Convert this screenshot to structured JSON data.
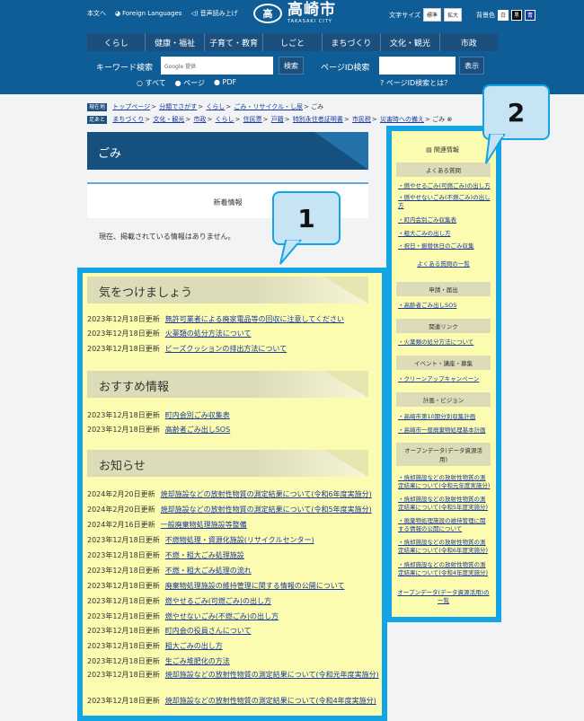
{
  "header": {
    "skip": "本文へ",
    "foreign": "Foreign Languages",
    "voice": "音声読み上げ",
    "logo_mark": "高",
    "logo_jp": "高崎市",
    "logo_en": "TAKASAKI CITY",
    "font_size_label": "文字サイズ",
    "font_std": "標準",
    "font_large": "拡大",
    "bg_label": "背景色",
    "bg_white": "白",
    "bg_black": "黒",
    "bg_blue": "青"
  },
  "gnav": [
    "くらし",
    "健康・福祉",
    "子育て・教育",
    "しごと",
    "まちづくり",
    "文化・観光",
    "市政"
  ],
  "search": {
    "keyword_label": "キーワード検索",
    "keyword_placeholder": "Google 提供",
    "keyword_btn": "検索",
    "radio_all": "○ すべて",
    "radio_page": "● ページ",
    "radio_pdf": "● PDF",
    "pageid_label": "ページID検索",
    "pageid_btn": "表示",
    "pageid_help": "? ページID検索とは？"
  },
  "breadcrumb1": {
    "tag": "現在地",
    "links": [
      "トップページ",
      "分類でさがす",
      "くらし",
      "ごみ・リサイクル・し尿"
    ],
    "current": "ごみ"
  },
  "breadcrumb2": {
    "tag": "足あと",
    "links": [
      "まちづくり",
      "文化・観光",
      "市政",
      "くらし",
      "住民票",
      "戸籍",
      "特別永住者証明書",
      "市民税",
      "災害時への備え"
    ],
    "current": "ごみ"
  },
  "main": {
    "title": "ごみ",
    "new_info": "新着情報",
    "no_info": "現在、掲載されている情報はありません。"
  },
  "sections": [
    {
      "heading": "気をつけましょう",
      "items": [
        {
          "date": "2023年12月18日更新",
          "text": "無許可業者による廃家電品等の回収に注意してください"
        },
        {
          "date": "2023年12月18日更新",
          "text": "火薬類の処分方法について"
        },
        {
          "date": "2023年12月18日更新",
          "text": "ビーズクッションの排出方法について"
        }
      ]
    },
    {
      "heading": "おすすめ情報",
      "items": [
        {
          "date": "2023年12月18日更新",
          "text": "町内会別ごみ収集表"
        },
        {
          "date": "2023年12月18日更新",
          "text": "高齢者ごみ出しSOS"
        }
      ]
    },
    {
      "heading": "お知らせ",
      "items": [
        {
          "date": "2024年2月20日更新",
          "text": "焼却施設などの放射性物質の測定結果について(令和6年度実施分)"
        },
        {
          "date": "2024年2月20日更新",
          "text": "焼却施設などの放射性物質の測定結果について(令和5年度実施分)"
        },
        {
          "date": "2024年2月16日更新",
          "text": "一般廃棄物処理施設等整備"
        },
        {
          "date": "2023年12月18日更新",
          "text": "不燃物処理・資源化施設(リサイクルセンター)"
        },
        {
          "date": "2023年12月18日更新",
          "text": "不燃・粗大ごみ処理施設"
        },
        {
          "date": "2023年12月18日更新",
          "text": "不燃・粗大ごみ処理の流れ"
        },
        {
          "date": "2023年12月18日更新",
          "text": "廃棄物処理施設の維持管理に関する情報の公開について"
        },
        {
          "date": "2023年12月18日更新",
          "text": "燃やせるごみ(可燃ごみ)の出し方"
        },
        {
          "date": "2023年12月18日更新",
          "text": "燃やせないごみ(不燃ごみ)の出し方"
        },
        {
          "date": "2023年12月18日更新",
          "text": "町内会の役員さんについて"
        },
        {
          "date": "2023年12月18日更新",
          "text": "粗大ごみの出し方"
        },
        {
          "date": "2023年12月18日更新",
          "text": "生ごみ堆肥化の方法"
        },
        {
          "date": "2023年12月18日更新",
          "text": "焼却施設などの放射性物質の測定結果について(令和元年度実施分)"
        },
        {
          "date": "2023年12月18日更新",
          "text": "焼却施設などの放射性物質の測定結果について(令和4年度実施分)"
        }
      ]
    }
  ],
  "sidebar": {
    "heading": "関連情報",
    "faq_title": "よくある質問",
    "faq": [
      "燃やせるごみ(可燃ごみ)の出し方",
      "燃やせないごみ(不燃ごみ)の出し方",
      "町内会別ごみ収集表",
      "粗大ごみの出し方",
      "祝日・振替休日のごみ収集"
    ],
    "faq_more": "よくある質問の一覧",
    "apply_title": "申請・届出",
    "apply": [
      "高齢者ごみ出しSOS"
    ],
    "links_title": "関連リンク",
    "links": [
      "火薬類の処分方法について"
    ],
    "event_title": "イベント・講座・募集",
    "event": [
      "クリーンアップキャンペーン"
    ],
    "plan_title": "計画・ビジョン",
    "plan": [
      "高崎市第10期分別収集計画",
      "高崎市一般廃棄物処理基本計画"
    ],
    "opendata_title": "オープンデータ(データ資源活用)",
    "opendata": [
      "焼却施設などの放射性物質の測定結果について(令和元年度実施分)",
      "焼却施設などの放射性物質の測定結果について(令和5年度実施分)",
      "廃棄物処理施設の維持管理に関する情報の公開について",
      "焼却施設などの放射性物質の測定結果について(令和6年度実施分)",
      "焼却施設などの放射性物質の測定結果について(令和4年度実施分)"
    ],
    "opendata_more": "オープンデータ(データ資源活用)の一覧"
  },
  "callouts": {
    "one": "1",
    "two": "2"
  },
  "colors": {
    "header": "#0f5d97",
    "highlight_border": "#12a4e4",
    "highlight_fill": "#ffff96"
  }
}
